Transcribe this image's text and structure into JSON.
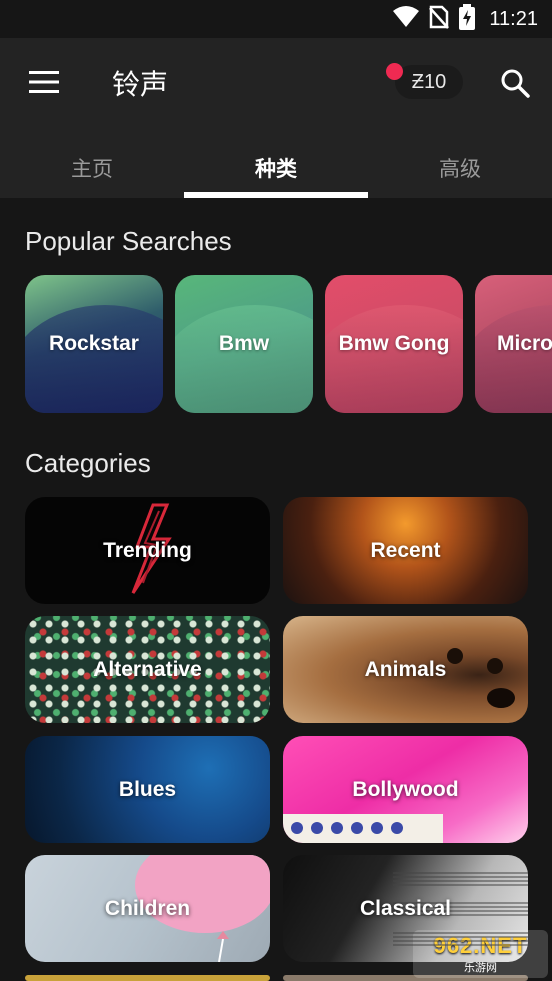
{
  "status_bar": {
    "time": "11:21",
    "icons": [
      "wifi-icon",
      "no-sim-icon",
      "battery-charging-icon"
    ]
  },
  "app_bar": {
    "title": "铃声",
    "menu_icon": "hamburger-menu-icon",
    "credits": "Ƶ10",
    "search_icon": "search-icon",
    "notification_dot_color": "#ef2a52"
  },
  "tabs": [
    {
      "label": "主页",
      "active": false
    },
    {
      "label": "种类",
      "active": true
    },
    {
      "label": "高级",
      "active": false
    }
  ],
  "popular": {
    "title": "Popular Searches",
    "items": [
      {
        "label": "Rockstar"
      },
      {
        "label": "Bmw"
      },
      {
        "label": "Bmw Gong"
      },
      {
        "label": "Micro"
      }
    ]
  },
  "categories": {
    "title": "Categories",
    "items": [
      {
        "label": "Trending"
      },
      {
        "label": "Recent"
      },
      {
        "label": "Alternative"
      },
      {
        "label": "Animals"
      },
      {
        "label": "Blues"
      },
      {
        "label": "Bollywood"
      },
      {
        "label": "Children"
      },
      {
        "label": "Classical"
      }
    ]
  },
  "watermark": {
    "main": "962.NET",
    "sub": "乐游网"
  }
}
